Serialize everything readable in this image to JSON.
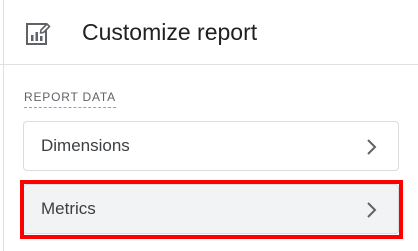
{
  "header": {
    "icon": "report-chart-edit-icon",
    "title": "Customize report"
  },
  "section": {
    "label": "REPORT DATA"
  },
  "items": [
    {
      "label": "Dimensions",
      "icon": "chevron-right-icon"
    },
    {
      "label": "Metrics",
      "icon": "chevron-right-icon"
    }
  ],
  "colors": {
    "highlight": "#ff0000",
    "hover_row": "#f1f3f4",
    "border": "#dadce0"
  }
}
